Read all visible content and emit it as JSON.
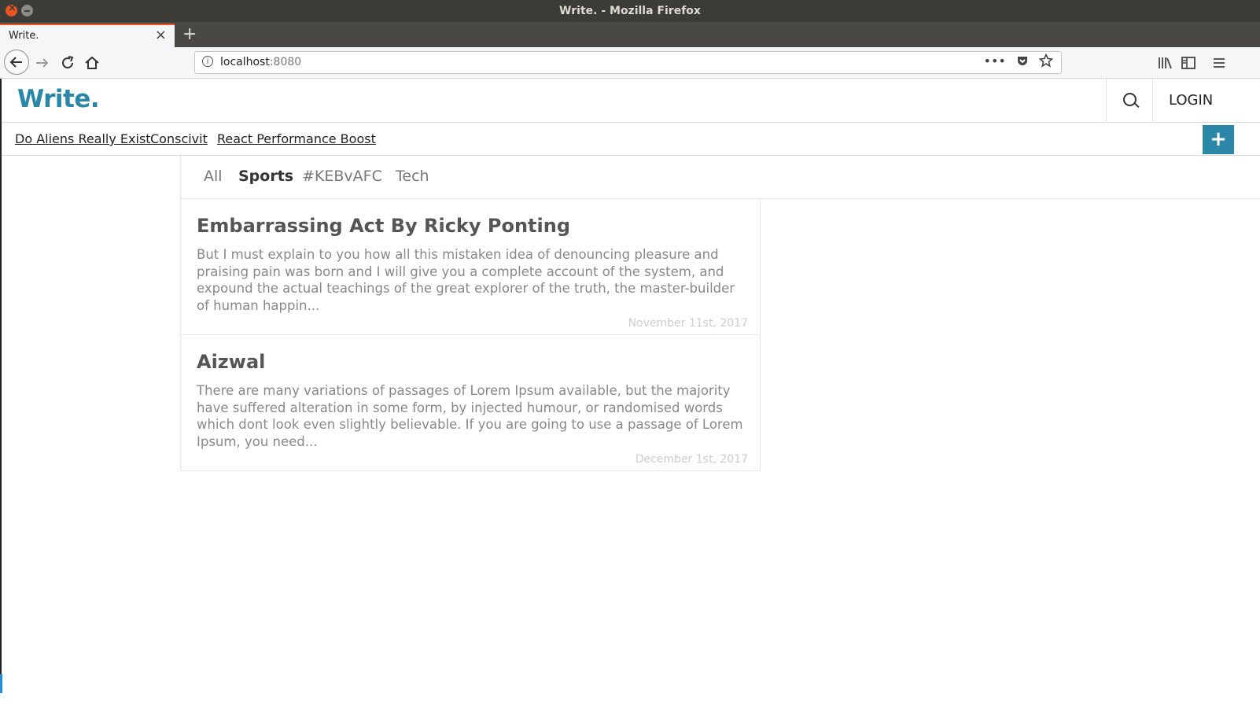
{
  "window": {
    "title": "Write. - Mozilla Firefox"
  },
  "browser": {
    "tab_label": "Write.",
    "tab_close": "×",
    "new_tab": "+",
    "url_host": "localhost",
    "url_port": ":8080",
    "url_info_icon": "i",
    "page_actions": "•••",
    "icons": [
      "back-icon",
      "forward-icon",
      "reload-icon",
      "home-icon",
      "page-actions-icon",
      "pocket-icon",
      "bookmark-star-icon",
      "library-icon",
      "sidebar-icon",
      "menu-icon"
    ]
  },
  "site": {
    "logo": "Write.",
    "login": "LOGIN",
    "add_button": "+",
    "accent_color": "#2a87a8"
  },
  "pinned": [
    {
      "label": "Do Aliens Really Exist"
    },
    {
      "label": "Conscivit"
    },
    {
      "label": "React Performance Boost"
    }
  ],
  "filters": [
    {
      "label": "All",
      "active": false
    },
    {
      "label": "Sports",
      "active": true
    },
    {
      "label": "#KEBvAFC",
      "active": false
    },
    {
      "label": "Tech",
      "active": false
    }
  ],
  "posts": [
    {
      "title": "Embarrassing Act By Ricky Ponting",
      "excerpt": "But I must explain to you how all this mistaken idea of denouncing pleasure and praising pain was born and I will give you a complete account of the system, and expound the actual teachings of the great explorer of the truth, the master-builder of human happin...",
      "date": "November 11st, 2017"
    },
    {
      "title": "Aizwal",
      "excerpt": "There are many variations of passages of Lorem Ipsum available, but the majority have suffered alteration in some form, by injected humour, or randomised words which dont look even slightly believable. If you are going to use a passage of Lorem Ipsum, you need...",
      "date": "December 1st, 2017"
    }
  ]
}
